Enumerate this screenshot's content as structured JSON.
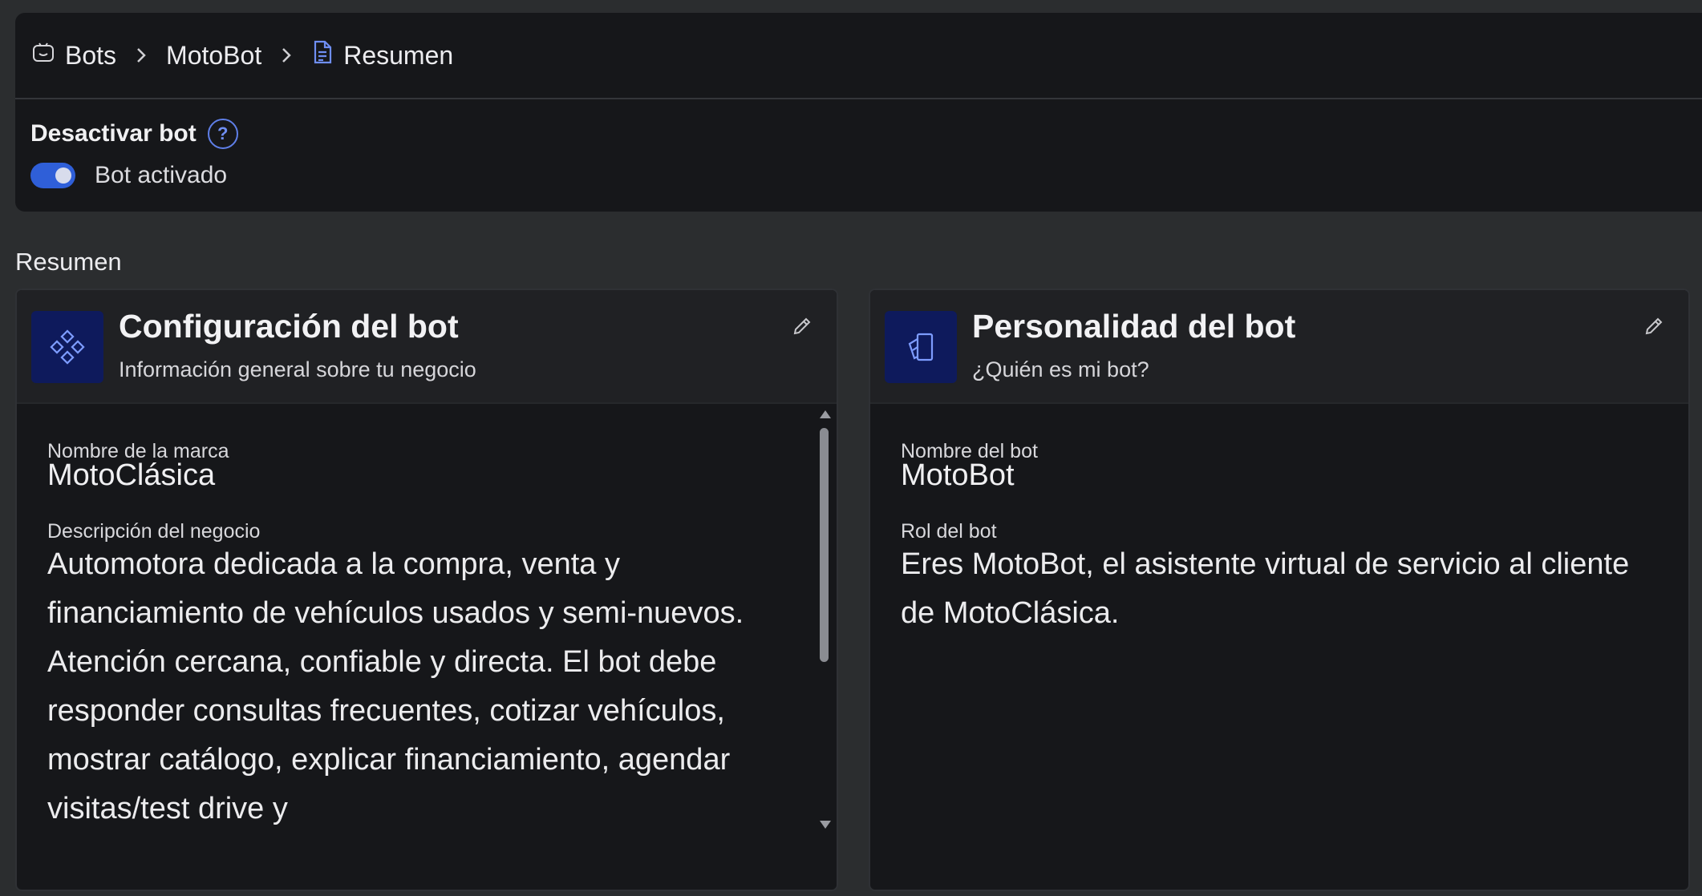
{
  "breadcrumb": {
    "items": [
      {
        "label": "Bots",
        "icon": "bot-icon"
      },
      {
        "label": "MotoBot"
      },
      {
        "label": "Resumen",
        "icon": "document-icon"
      }
    ]
  },
  "bot_status": {
    "title": "Desactivar bot",
    "help_icon": "help-circle-icon",
    "toggle_on": true,
    "toggle_label": "Bot activado",
    "accent_color": "#2f5fd8"
  },
  "summary": {
    "title": "Resumen",
    "config_card": {
      "title": "Configuración del bot",
      "subtitle": "Información general sobre tu negocio",
      "icon": "nodes-icon",
      "brand_label": "Nombre de la marca",
      "brand_value": "MotoClásica",
      "description_label": "Descripción del negocio",
      "description_value": "Automotora dedicada a la compra, venta y financiamiento de vehículos usados y semi-nuevos. Atención cercana, confiable y directa. El bot debe responder consultas frecuentes, cotizar vehículos, mostrar catálogo, explicar financiamiento, agendar visitas/test drive y"
    },
    "personality_card": {
      "title": "Personalidad del bot",
      "subtitle": "¿Quién es mi bot?",
      "icon": "personality-icon",
      "name_label": "Nombre del bot",
      "name_value": "MotoBot",
      "role_label": "Rol del bot",
      "role_value": "Eres MotoBot, el asistente virtual de servicio al cliente de MotoClásica."
    }
  }
}
